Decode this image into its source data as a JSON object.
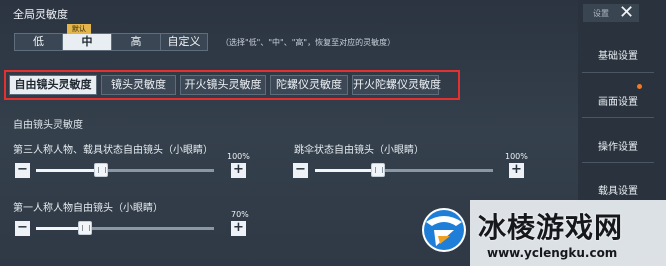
{
  "global": {
    "title": "全局灵敏度",
    "levels": [
      "低",
      "中",
      "高",
      "自定义"
    ],
    "selected_level": "中",
    "default_badge": "默认",
    "hint": "（选择\"低\"、\"中\"、\"高\"，恢复至对应的灵敏度）"
  },
  "tabs": [
    "自由镜头灵敏度",
    "镜头灵敏度",
    "开火镜头灵敏度",
    "陀螺仪灵敏度",
    "开火陀螺仪灵敏度"
  ],
  "selected_tab": "自由镜头灵敏度",
  "section": {
    "title": "自由镜头灵敏度",
    "sliders": [
      {
        "label": "第三人称人物、载具状态自由镜头（小眼睛）",
        "percent_text": "100%",
        "value": 100
      },
      {
        "label": "跳伞状态自由镜头（小眼睛）",
        "percent_text": "100%",
        "value": 100
      },
      {
        "label": "第一人称人物自由镜头（小眼睛）",
        "percent_text": "70%",
        "value": 70
      }
    ],
    "minus": "−",
    "plus": "+"
  },
  "sidebar": {
    "header": "设置",
    "close_icon": "close-icon",
    "items": [
      "基础设置",
      "画面设置",
      "操作设置",
      "载具设置"
    ]
  },
  "watermark": {
    "text": "冰棱游戏网",
    "url": "www.yclengku.com"
  },
  "colors": {
    "accent_red": "#e3312f",
    "badge_gold": "#e2b64a",
    "notice_dot": "#f07a2a"
  }
}
